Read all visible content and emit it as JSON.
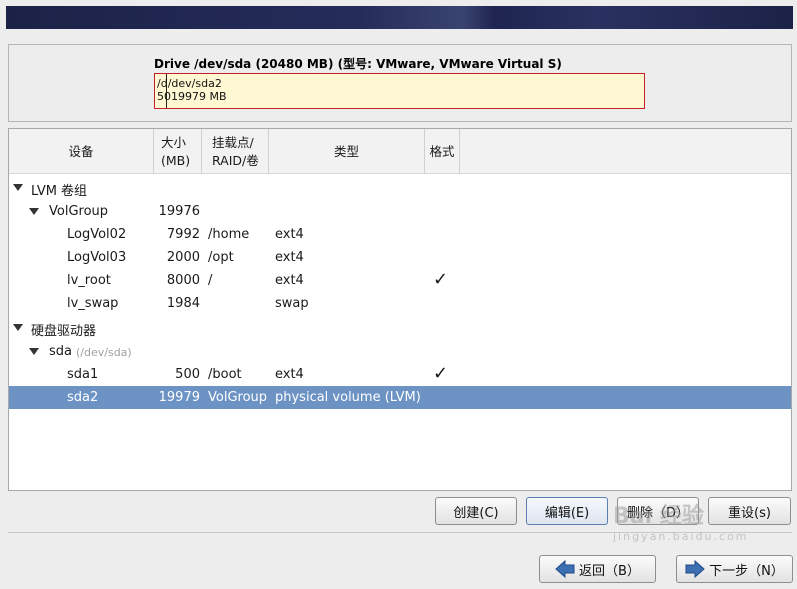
{
  "drive": {
    "title": "Drive /dev/sda (20480 MB) (型号: VMware, VMware Virtual S)",
    "segment_line1": "/d/dev/sda2",
    "segment_line2": "5019979 MB"
  },
  "table": {
    "headers": {
      "device": "设备",
      "size_line1": "大小",
      "size_line2": "(MB)",
      "mount_line1": "挂载点/",
      "mount_line2": "RAID/卷",
      "type": "类型",
      "format": "格式"
    },
    "rows": [
      {
        "name": "LVM 卷组",
        "size": "",
        "mount": "",
        "type": "",
        "format": ""
      },
      {
        "name": "VolGroup",
        "size": "19976",
        "mount": "",
        "type": "",
        "format": ""
      },
      {
        "name": "LogVol02",
        "size": "7992",
        "mount": "/home",
        "type": "ext4",
        "format": ""
      },
      {
        "name": "LogVol03",
        "size": "2000",
        "mount": "/opt",
        "type": "ext4",
        "format": ""
      },
      {
        "name": "lv_root",
        "size": "8000",
        "mount": "/",
        "type": "ext4",
        "format": "✓"
      },
      {
        "name": "lv_swap",
        "size": "1984",
        "mount": "",
        "type": "swap",
        "format": ""
      },
      {
        "name": "硬盘驱动器",
        "size": "",
        "mount": "",
        "type": "",
        "format": ""
      },
      {
        "name": "sda",
        "path": "(/dev/sda)",
        "size": "",
        "mount": "",
        "type": "",
        "format": ""
      },
      {
        "name": "sda1",
        "size": "500",
        "mount": "/boot",
        "type": "ext4",
        "format": "✓"
      },
      {
        "name": "sda2",
        "size": "19979",
        "mount": "VolGroup",
        "type": "physical volume (LVM)",
        "format": ""
      }
    ]
  },
  "actions": {
    "create": "创建(C)",
    "edit": "编辑(E)",
    "delete": "删除（D）",
    "reset": "重设(s)"
  },
  "nav": {
    "back": "返回（B）",
    "next": "下一步（N）"
  },
  "watermark": {
    "text": "Bai 经验",
    "sub": "jingyan.baidu.com"
  },
  "colors": {
    "selection": "#6c93c4",
    "drive_border": "#c0202a",
    "drive_fill": "#fff8d2",
    "banner": "#1c2247"
  }
}
